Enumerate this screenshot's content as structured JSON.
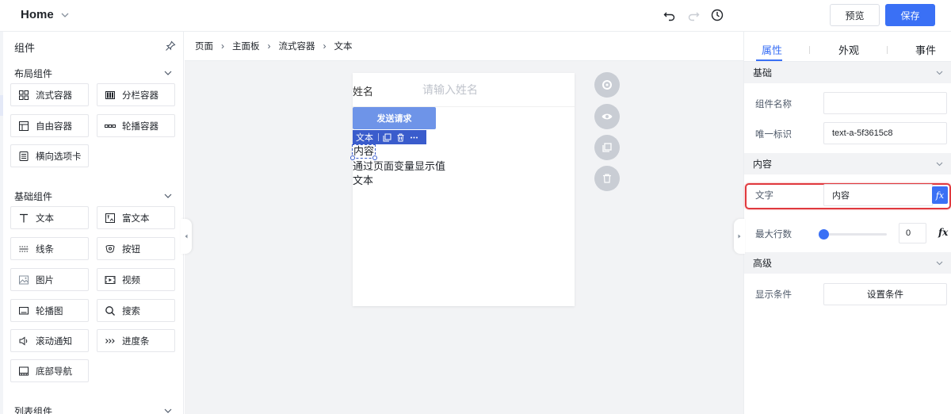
{
  "topbar": {
    "title": "Home",
    "preview_label": "预览",
    "save_label": "保存"
  },
  "left_panel": {
    "title": "组件",
    "sections": [
      {
        "title": "布局组件",
        "items": [
          {
            "label": "流式容器",
            "icon": "grid-icon"
          },
          {
            "label": "分栏容器",
            "icon": "columns-icon"
          },
          {
            "label": "自由容器",
            "icon": "free-layout-icon"
          },
          {
            "label": "轮播容器",
            "icon": "carousel-dots-icon"
          },
          {
            "label": "横向选项卡",
            "icon": "tabs-icon"
          }
        ]
      },
      {
        "title": "基础组件",
        "items": [
          {
            "label": "文本",
            "icon": "text-icon"
          },
          {
            "label": "富文本",
            "icon": "rich-text-icon"
          },
          {
            "label": "线条",
            "icon": "divider-icon"
          },
          {
            "label": "按钮",
            "icon": "button-icon"
          },
          {
            "label": "图片",
            "icon": "image-icon"
          },
          {
            "label": "视频",
            "icon": "video-icon"
          },
          {
            "label": "轮播图",
            "icon": "slideshow-icon"
          },
          {
            "label": "搜索",
            "icon": "search-icon"
          },
          {
            "label": "滚动通知",
            "icon": "speaker-icon"
          },
          {
            "label": "进度条",
            "icon": "progress-icon"
          },
          {
            "label": "底部导航",
            "icon": "bottom-nav-icon"
          }
        ]
      },
      {
        "title": "列表组件",
        "items": []
      }
    ]
  },
  "canvas": {
    "breadcrumb": [
      "页面",
      "主面板",
      "流式容器",
      "文本"
    ],
    "form": {
      "name_label": "姓名",
      "name_placeholder": "请输入姓名",
      "send_button": "发送请求"
    },
    "selection_toolbar": {
      "label": "文本"
    },
    "selected_text": "内容",
    "texts": [
      "通过页面变量显示值",
      "文本"
    ]
  },
  "right_panel": {
    "tabs": [
      "属性",
      "外观",
      "事件"
    ],
    "active_tab": "属性",
    "groups": {
      "basic": "基础",
      "content": "内容",
      "advanced": "高级"
    },
    "fields": {
      "component_name_label": "组件名称",
      "component_name_value": "",
      "unique_id_label": "唯一标识",
      "unique_id_value": "text-a-5f3615c8",
      "text_label": "文字",
      "text_value": "内容",
      "fx_label": "fx",
      "max_lines_label": "最大行数",
      "max_lines_value": "0",
      "display_condition_label": "显示条件",
      "set_condition_button": "设置条件"
    }
  },
  "colors": {
    "accent": "#3a70f5",
    "highlight": "#e0393e",
    "send_button": "#6e94e8",
    "selection": "#3a5ccc"
  }
}
